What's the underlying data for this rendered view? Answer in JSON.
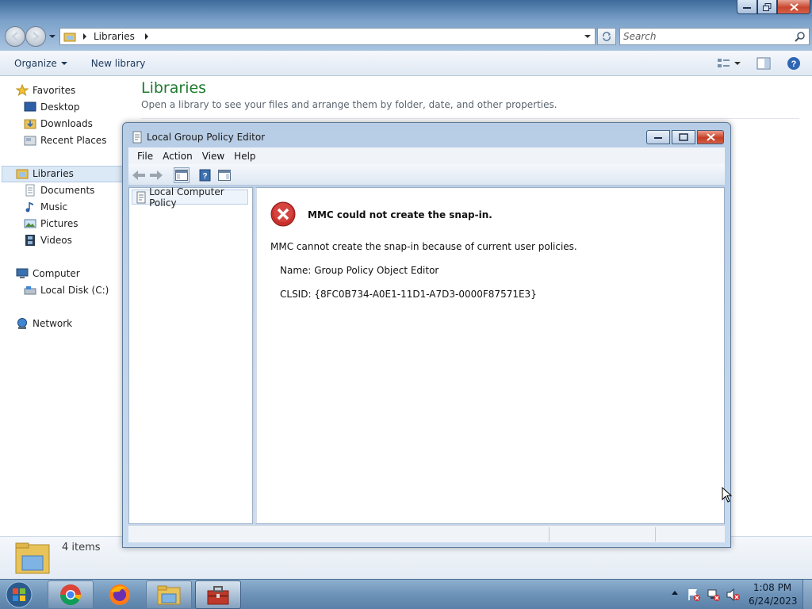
{
  "explorer": {
    "address": "Libraries",
    "search_placeholder": "Search",
    "commands": {
      "organize": "Organize",
      "new_library": "New library"
    },
    "nav": {
      "favorites": "Favorites",
      "desktop": "Desktop",
      "downloads": "Downloads",
      "recent_places": "Recent Places",
      "libraries": "Libraries",
      "documents": "Documents",
      "music": "Music",
      "pictures": "Pictures",
      "videos": "Videos",
      "computer": "Computer",
      "local_disk": "Local Disk (C:)",
      "network": "Network"
    },
    "content": {
      "title": "Libraries",
      "subtitle": "Open a library to see your files and arrange them by folder, date, and other properties."
    },
    "details": {
      "count": "4 items"
    }
  },
  "mmc": {
    "title": "Local Group Policy Editor",
    "menu": {
      "file": "File",
      "action": "Action",
      "view": "View",
      "help": "Help"
    },
    "tree_root": "Local Computer Policy",
    "error": {
      "title": "MMC could not create the snap-in.",
      "message": "MMC cannot create the snap-in because of current user policies.",
      "name": "Name: Group Policy Object Editor",
      "clsid": "CLSID: {8FC0B734-A0E1-11D1-A7D3-0000F87571E3}"
    }
  },
  "taskbar": {
    "time": "1:08 PM",
    "date": "6/24/2023"
  }
}
